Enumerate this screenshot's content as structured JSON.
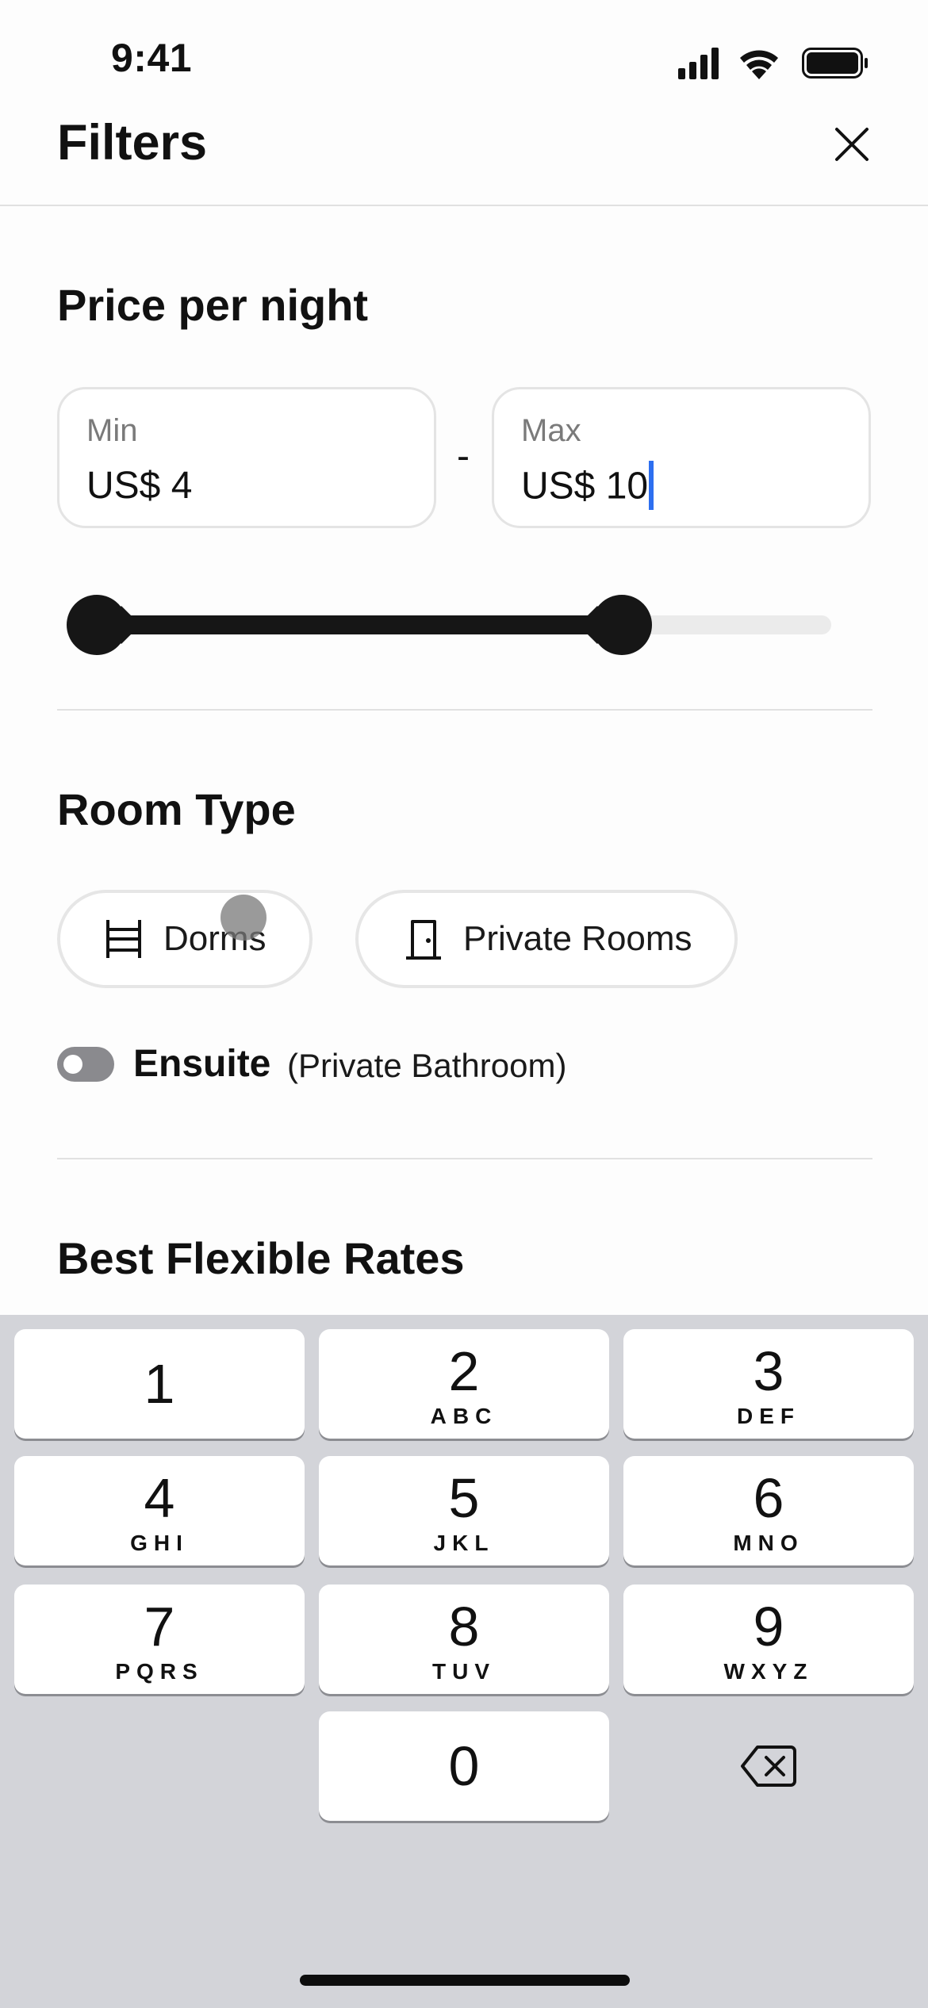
{
  "status_bar": {
    "time": "9:41"
  },
  "header": {
    "title": "Filters"
  },
  "price": {
    "title": "Price per night",
    "min_label": "Min",
    "min_value": "US$ 4",
    "separator": "-",
    "max_label": "Max",
    "max_value": "US$ 10",
    "slider": {
      "min_fraction": 0.0,
      "max_fraction": 0.72
    }
  },
  "room_type": {
    "title": "Room Type",
    "options": [
      {
        "label": "Dorms",
        "icon": "bunk-bed-icon"
      },
      {
        "label": "Private Rooms",
        "icon": "door-icon"
      }
    ],
    "ensuite_label": "Ensuite",
    "ensuite_sub": "(Private Bathroom)",
    "ensuite_on": false
  },
  "flexible_rates": {
    "title": "Best Flexible Rates"
  },
  "keyboard": {
    "keys": [
      {
        "num": "1",
        "letters": ""
      },
      {
        "num": "2",
        "letters": "ABC"
      },
      {
        "num": "3",
        "letters": "DEF"
      },
      {
        "num": "4",
        "letters": "GHI"
      },
      {
        "num": "5",
        "letters": "JKL"
      },
      {
        "num": "6",
        "letters": "MNO"
      },
      {
        "num": "7",
        "letters": "PQRS"
      },
      {
        "num": "8",
        "letters": "TUV"
      },
      {
        "num": "9",
        "letters": "WXYZ"
      },
      {
        "num": "0",
        "letters": ""
      }
    ],
    "backspace_icon": "backspace-icon"
  },
  "colors": {
    "caret": "#2d6ff0",
    "slider_fill": "#161616",
    "toggle_off": "#8a8a8e",
    "keyboard_bg": "#d3d4d9"
  }
}
